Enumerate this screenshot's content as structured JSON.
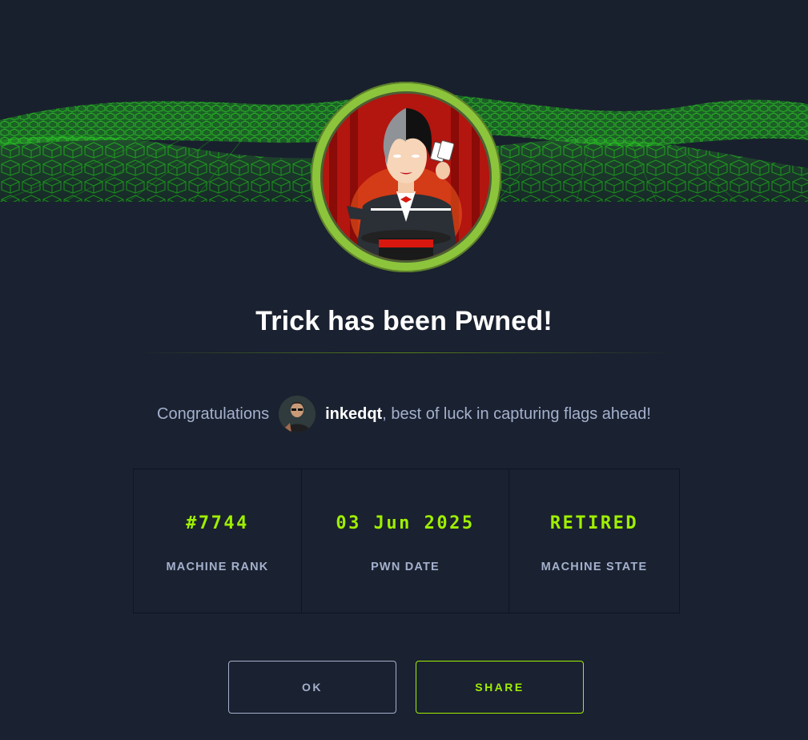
{
  "banner": {
    "accent_color": "#9fef00",
    "image": "green-digital-wave-banner"
  },
  "machine": {
    "avatar": "magician-trick-machine-avatar",
    "title": "Trick has been Pwned!"
  },
  "congrats": {
    "prefix": "Congratulations",
    "user_avatar": "user-avatar-icon",
    "username": "inkedqt",
    "suffix": ", best of luck in capturing flags ahead!"
  },
  "stats": [
    {
      "value": "#7744",
      "label": "MACHINE RANK"
    },
    {
      "value": "03 Jun 2025",
      "label": "PWN DATE"
    },
    {
      "value": "RETIRED",
      "label": "MACHINE STATE"
    }
  ],
  "buttons": {
    "ok_label": "OK",
    "share_label": "SHARE"
  },
  "colors": {
    "background": "#1a2130",
    "accent": "#9fef00",
    "muted_text": "#a4b1cd"
  }
}
